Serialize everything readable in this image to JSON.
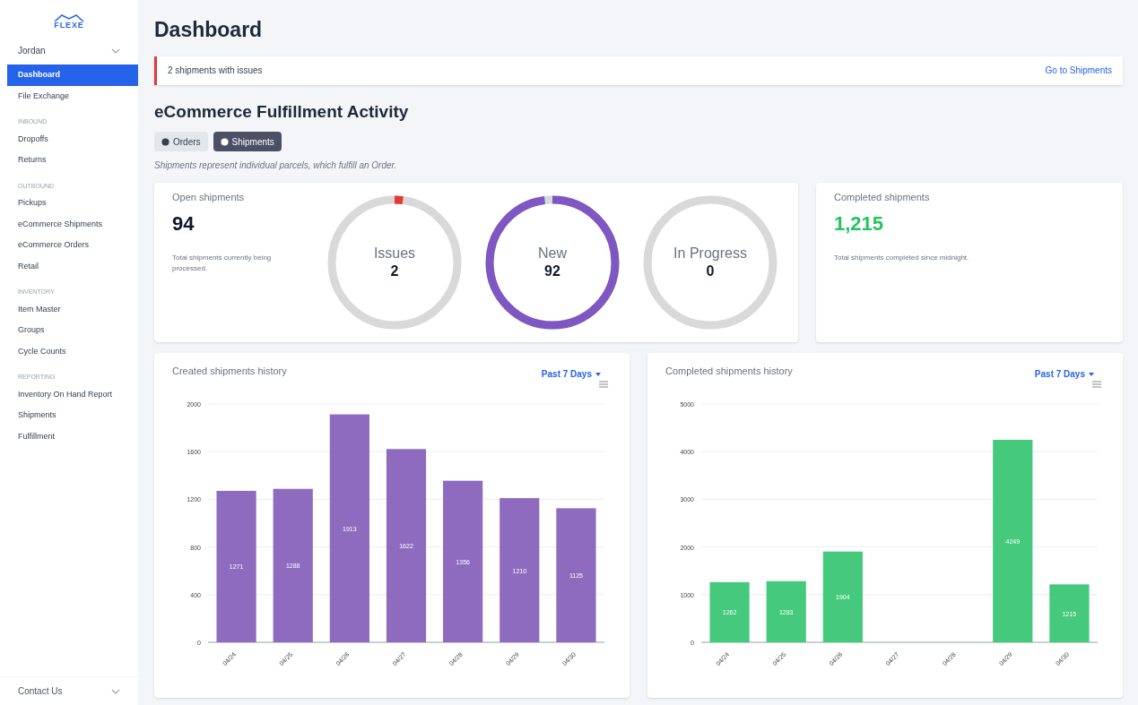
{
  "sidebar": {
    "logo": "FLEXE",
    "user": "Jordan",
    "items": [
      {
        "kind": "item",
        "label": "Dashboard",
        "selected": true
      },
      {
        "kind": "item",
        "label": "File Exchange",
        "selected": false
      },
      {
        "kind": "header",
        "label": "INBOUND"
      },
      {
        "kind": "item",
        "label": "Dropoffs",
        "selected": false
      },
      {
        "kind": "item",
        "label": "Returns",
        "selected": false
      },
      {
        "kind": "header",
        "label": "OUTBOUND"
      },
      {
        "kind": "item",
        "label": "Pickups",
        "selected": false
      },
      {
        "kind": "item",
        "label": "eCommerce Shipments",
        "selected": false
      },
      {
        "kind": "item",
        "label": "eCommerce Orders",
        "selected": false
      },
      {
        "kind": "item",
        "label": "Retail",
        "selected": false
      },
      {
        "kind": "header",
        "label": "INVENTORY"
      },
      {
        "kind": "item",
        "label": "Item Master",
        "selected": false
      },
      {
        "kind": "item",
        "label": "Groups",
        "selected": false
      },
      {
        "kind": "item",
        "label": "Cycle Counts",
        "selected": false
      },
      {
        "kind": "header",
        "label": "REPORTING"
      },
      {
        "kind": "item",
        "label": "Inventory On Hand Report",
        "selected": false
      },
      {
        "kind": "item",
        "label": "Shipments",
        "selected": false
      },
      {
        "kind": "item",
        "label": "Fulfillment",
        "selected": false
      }
    ],
    "footer": "Contact Us"
  },
  "page_title": "Dashboard",
  "alert": {
    "message": "2 shipments with issues",
    "link": "Go to Shipments"
  },
  "section_title": "eCommerce Fulfillment Activity",
  "tabs": [
    {
      "label": "Orders",
      "selected": false
    },
    {
      "label": "Shipments",
      "selected": true
    }
  ],
  "caption": "Shipments represent individual parcels, which fulfill an Order.",
  "open_card": {
    "title": "Open shipments",
    "value": "94",
    "note": "Total shipments currently being processed."
  },
  "rings": [
    {
      "kind": "issues",
      "label": "Issues",
      "value": "2"
    },
    {
      "kind": "new",
      "label": "New",
      "value": "92"
    },
    {
      "kind": "progress",
      "label": "In Progress",
      "value": "0"
    }
  ],
  "completed_card": {
    "title": "Completed shipments",
    "value": "1,215",
    "note": "Total shipments completed since midnight."
  },
  "charts": [
    {
      "title": "Created shipments history",
      "range": "Past 7 Days",
      "chart_data": {
        "type": "bar",
        "categories": [
          "04/24",
          "04/25",
          "04/26",
          "04/27",
          "04/28",
          "04/29",
          "04/30"
        ],
        "series": [
          {
            "color": "#8e6bbf",
            "values": [
              1271,
              1288,
              1913,
              1622,
              1356,
              1210,
              1125
            ]
          }
        ],
        "ylim": [
          0,
          2000
        ],
        "grid": true,
        "yticks": [
          0,
          400,
          800,
          1200,
          1600,
          2000
        ],
        "data_labels": true
      }
    },
    {
      "title": "Completed shipments history",
      "range": "Past 7 Days",
      "chart_data": {
        "type": "bar",
        "categories": [
          "04/24",
          "04/25",
          "04/26",
          "04/27",
          "04/28",
          "04/29",
          "04/30"
        ],
        "series": [
          {
            "color": "#45c97d",
            "values": [
              1262,
              1283,
              1904,
              null,
              null,
              4249,
              1215
            ]
          }
        ],
        "ylim": [
          0,
          5000
        ],
        "grid": true,
        "yticks": [
          0,
          1000,
          2000,
          3000,
          4000,
          5000
        ],
        "data_labels": true
      }
    }
  ]
}
